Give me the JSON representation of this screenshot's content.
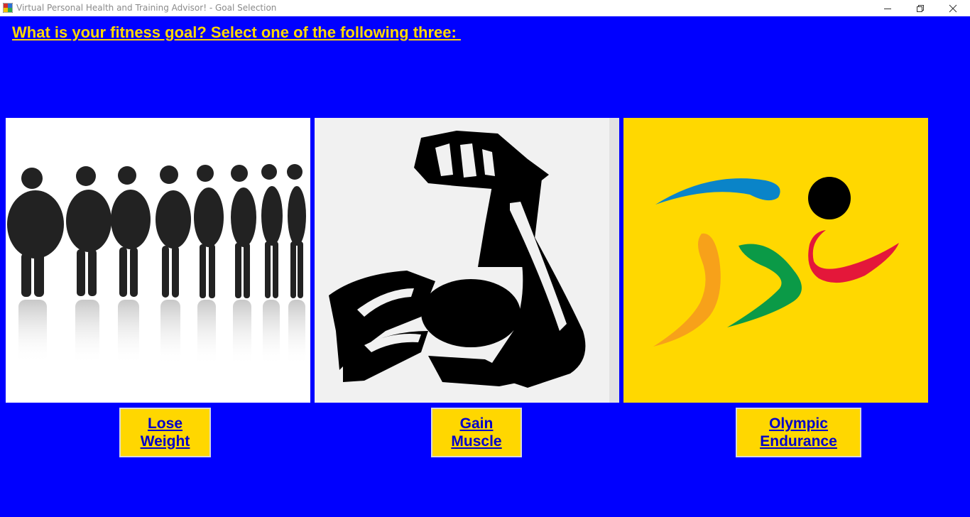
{
  "window": {
    "title": "Virtual Personal Health and Training Advisor! - Goal Selection",
    "controls": [
      "minimize",
      "maximize",
      "close"
    ]
  },
  "colors": {
    "background": "#0000FF",
    "heading": "#FFD700",
    "button_face": "#FFD700",
    "button_text": "#0000CC"
  },
  "heading": "What is your fitness goal? Select one of the following three: ",
  "goals": [
    {
      "image": "weight-loss-silhouettes",
      "line1": "Lose",
      "line2": "Weight"
    },
    {
      "image": "flexed-bicep-arm",
      "line1": "Gain",
      "line2": "Muscle"
    },
    {
      "image": "olympic-runner-figure",
      "line1": "Olympic",
      "line2": "Endurance"
    }
  ]
}
